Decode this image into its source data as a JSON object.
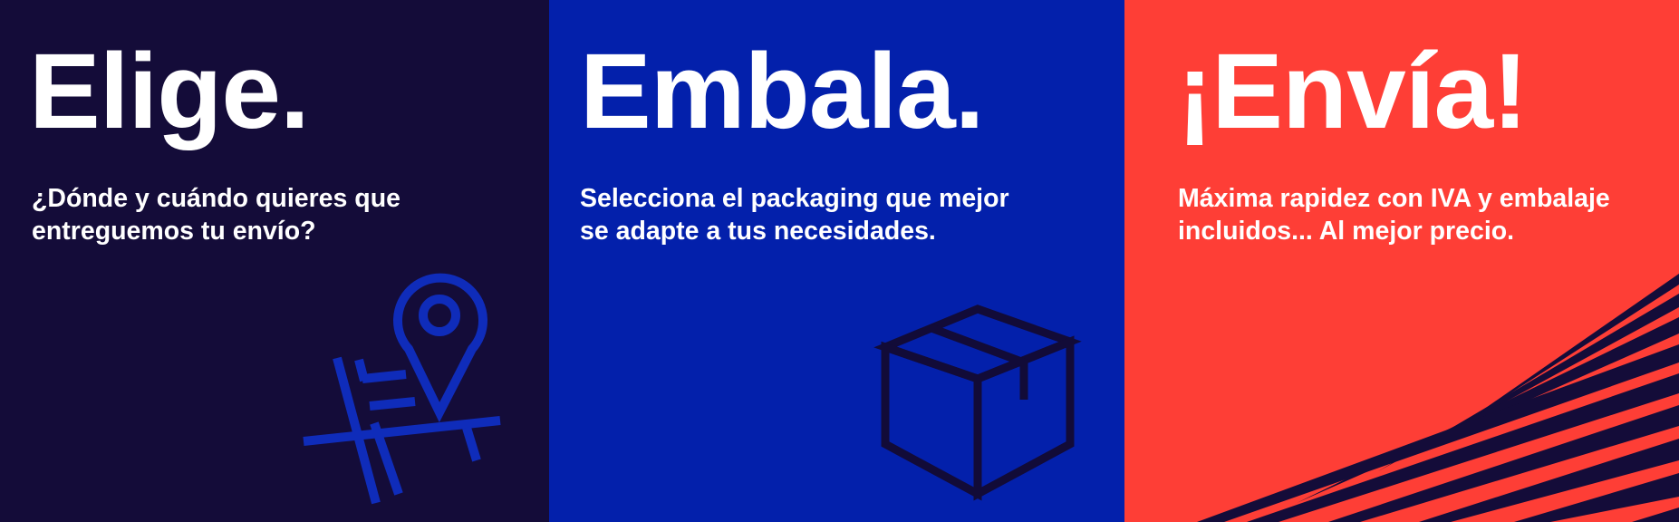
{
  "colors": {
    "panel_1_bg": "#140c39",
    "panel_2_bg": "#0320ab",
    "panel_3_bg": "#fe3e36",
    "text": "#ffffff",
    "illustration_blue": "#0f2cba",
    "illustration_navy": "#120b38"
  },
  "panels": [
    {
      "headline": "Elige.",
      "subtitle_lines": [
        "¿Dónde y cuándo quieres que",
        "entreguemos tu envío?"
      ],
      "icon": "map-location-pin-icon"
    },
    {
      "headline": "Embala.",
      "subtitle_lines": [
        "Selecciona el packaging que mejor",
        "se adapte a tus necesidades."
      ],
      "icon": "cardboard-box-icon"
    },
    {
      "headline": "¡Envía!",
      "subtitle_lines": [
        "Máxima rapidez con IVA y embalaje",
        "incluidos... Al mejor precio."
      ],
      "icon": "speed-stripes-decoration"
    }
  ]
}
